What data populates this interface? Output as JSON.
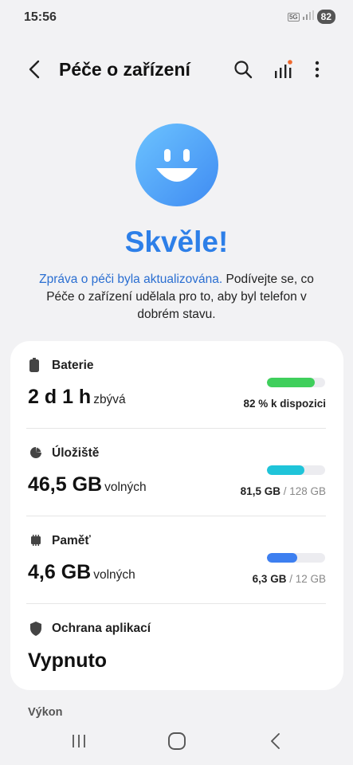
{
  "status": {
    "time": "15:56",
    "network": "5G",
    "battery": "82"
  },
  "header": {
    "title": "Péče o zařízení"
  },
  "hero": {
    "title": "Skvěle!",
    "link_text": "Zpráva o péči byla aktualizována.",
    "message": "Podívejte se, co Péče o zařízení udělala pro to, aby byl telefon v dobrém stavu."
  },
  "items": [
    {
      "label": "Baterie",
      "value": "2 d 1 h",
      "unit": "zbývá",
      "detail": "82 % k dispozici",
      "fraction": 0.82,
      "color": "#3fcf5c"
    },
    {
      "label": "Úložiště",
      "value": "46,5 GB",
      "unit": "volných",
      "used": "81,5 GB",
      "total": "128 GB",
      "fraction": 0.637,
      "color": "#1fc4d9"
    },
    {
      "label": "Paměť",
      "value": "4,6 GB",
      "unit": "volných",
      "used": "6,3 GB",
      "total": "12 GB",
      "fraction": 0.525,
      "color": "#3d7ff0"
    },
    {
      "label": "Ochrana aplikací",
      "value": "Vypnuto"
    }
  ],
  "next_section": "Výkon",
  "icons": [
    "back-arrow-icon",
    "search-icon",
    "signal-bars-icon",
    "more-vert-icon",
    "battery-icon",
    "storage-pie-icon",
    "memory-chip-icon",
    "shield-icon",
    "recents-icon",
    "home-icon",
    "nav-back-icon"
  ]
}
